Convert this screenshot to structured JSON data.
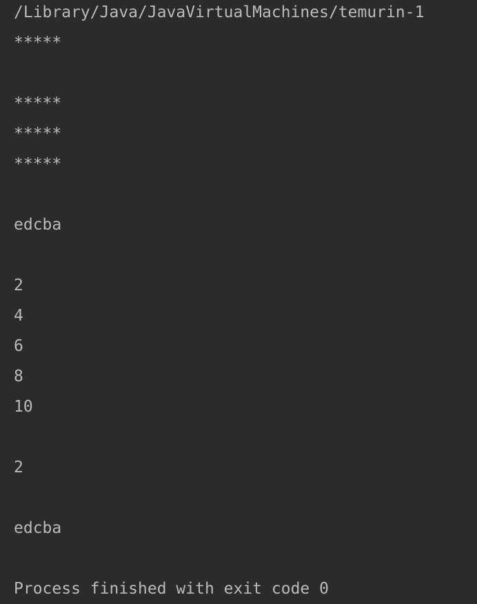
{
  "console": {
    "lines": [
      "/Library/Java/JavaVirtualMachines/temurin-1",
      "*****",
      "",
      "*****",
      "*****",
      "*****",
      "",
      "edcba",
      "",
      "2",
      "4",
      "6",
      "8",
      "10",
      "",
      "2",
      "",
      "edcba",
      "",
      "Process finished with exit code 0"
    ]
  },
  "colors": {
    "background": "#2b2b2b",
    "text": "#bbbbbb"
  }
}
